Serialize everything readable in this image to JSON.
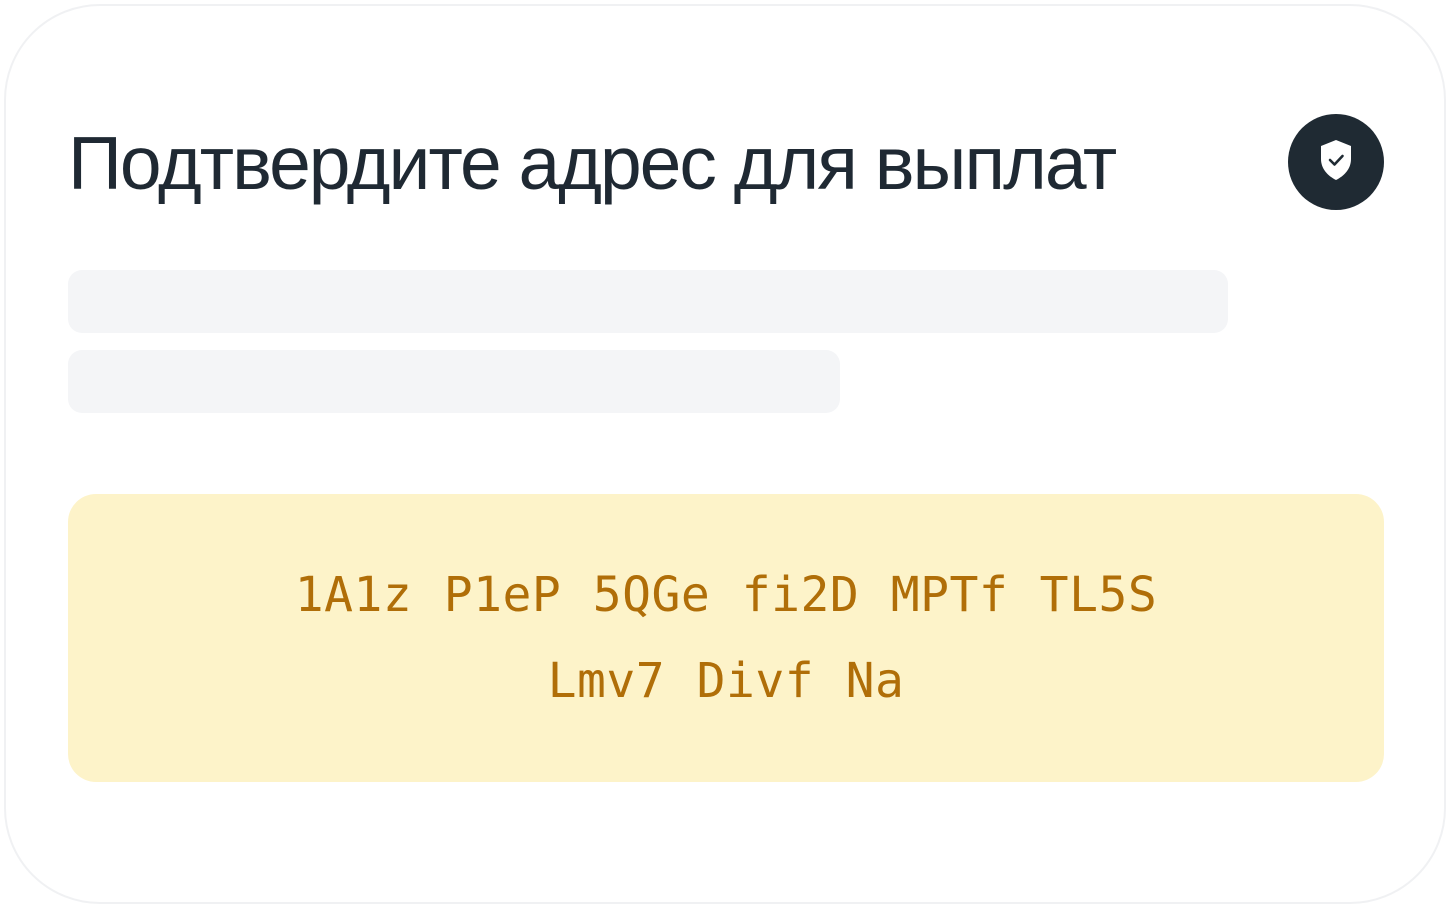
{
  "dialog": {
    "title": "Подтвердите адрес для выплат",
    "badge_icon": "shield-check-icon",
    "address": "1A1z P1eP 5QGe fi2D MPTf TL5S Lmv7 Divf Na"
  },
  "colors": {
    "title_text": "#1f2933",
    "badge_background": "#1f2a33",
    "skeleton": "#f4f5f7",
    "address_background": "#fdf3c9",
    "address_text": "#b06e08"
  }
}
